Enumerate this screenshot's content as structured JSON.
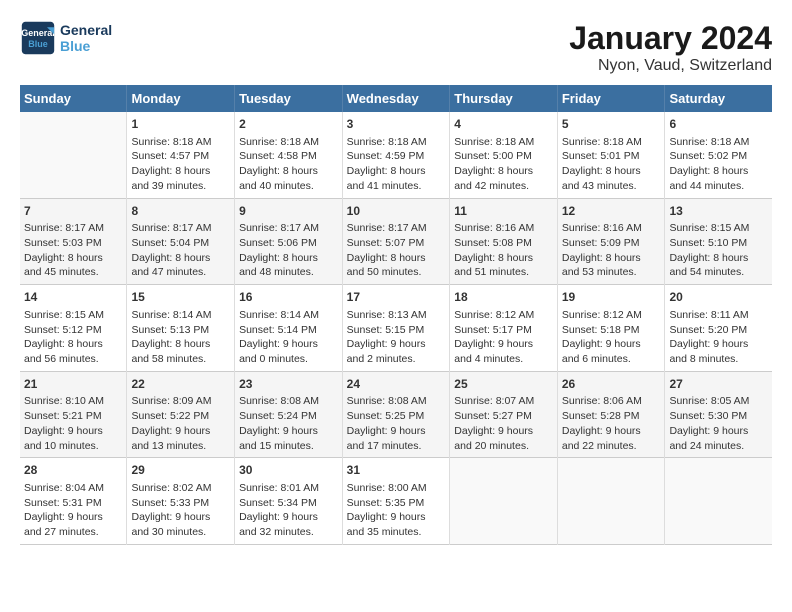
{
  "header": {
    "logo_line1": "General",
    "logo_line2": "Blue",
    "title": "January 2024",
    "subtitle": "Nyon, Vaud, Switzerland"
  },
  "days_of_week": [
    "Sunday",
    "Monday",
    "Tuesday",
    "Wednesday",
    "Thursday",
    "Friday",
    "Saturday"
  ],
  "weeks": [
    [
      {
        "day": "",
        "info": ""
      },
      {
        "day": "1",
        "info": "Sunrise: 8:18 AM\nSunset: 4:57 PM\nDaylight: 8 hours\nand 39 minutes."
      },
      {
        "day": "2",
        "info": "Sunrise: 8:18 AM\nSunset: 4:58 PM\nDaylight: 8 hours\nand 40 minutes."
      },
      {
        "day": "3",
        "info": "Sunrise: 8:18 AM\nSunset: 4:59 PM\nDaylight: 8 hours\nand 41 minutes."
      },
      {
        "day": "4",
        "info": "Sunrise: 8:18 AM\nSunset: 5:00 PM\nDaylight: 8 hours\nand 42 minutes."
      },
      {
        "day": "5",
        "info": "Sunrise: 8:18 AM\nSunset: 5:01 PM\nDaylight: 8 hours\nand 43 minutes."
      },
      {
        "day": "6",
        "info": "Sunrise: 8:18 AM\nSunset: 5:02 PM\nDaylight: 8 hours\nand 44 minutes."
      }
    ],
    [
      {
        "day": "7",
        "info": "Sunrise: 8:17 AM\nSunset: 5:03 PM\nDaylight: 8 hours\nand 45 minutes."
      },
      {
        "day": "8",
        "info": "Sunrise: 8:17 AM\nSunset: 5:04 PM\nDaylight: 8 hours\nand 47 minutes."
      },
      {
        "day": "9",
        "info": "Sunrise: 8:17 AM\nSunset: 5:06 PM\nDaylight: 8 hours\nand 48 minutes."
      },
      {
        "day": "10",
        "info": "Sunrise: 8:17 AM\nSunset: 5:07 PM\nDaylight: 8 hours\nand 50 minutes."
      },
      {
        "day": "11",
        "info": "Sunrise: 8:16 AM\nSunset: 5:08 PM\nDaylight: 8 hours\nand 51 minutes."
      },
      {
        "day": "12",
        "info": "Sunrise: 8:16 AM\nSunset: 5:09 PM\nDaylight: 8 hours\nand 53 minutes."
      },
      {
        "day": "13",
        "info": "Sunrise: 8:15 AM\nSunset: 5:10 PM\nDaylight: 8 hours\nand 54 minutes."
      }
    ],
    [
      {
        "day": "14",
        "info": "Sunrise: 8:15 AM\nSunset: 5:12 PM\nDaylight: 8 hours\nand 56 minutes."
      },
      {
        "day": "15",
        "info": "Sunrise: 8:14 AM\nSunset: 5:13 PM\nDaylight: 8 hours\nand 58 minutes."
      },
      {
        "day": "16",
        "info": "Sunrise: 8:14 AM\nSunset: 5:14 PM\nDaylight: 9 hours\nand 0 minutes."
      },
      {
        "day": "17",
        "info": "Sunrise: 8:13 AM\nSunset: 5:15 PM\nDaylight: 9 hours\nand 2 minutes."
      },
      {
        "day": "18",
        "info": "Sunrise: 8:12 AM\nSunset: 5:17 PM\nDaylight: 9 hours\nand 4 minutes."
      },
      {
        "day": "19",
        "info": "Sunrise: 8:12 AM\nSunset: 5:18 PM\nDaylight: 9 hours\nand 6 minutes."
      },
      {
        "day": "20",
        "info": "Sunrise: 8:11 AM\nSunset: 5:20 PM\nDaylight: 9 hours\nand 8 minutes."
      }
    ],
    [
      {
        "day": "21",
        "info": "Sunrise: 8:10 AM\nSunset: 5:21 PM\nDaylight: 9 hours\nand 10 minutes."
      },
      {
        "day": "22",
        "info": "Sunrise: 8:09 AM\nSunset: 5:22 PM\nDaylight: 9 hours\nand 13 minutes."
      },
      {
        "day": "23",
        "info": "Sunrise: 8:08 AM\nSunset: 5:24 PM\nDaylight: 9 hours\nand 15 minutes."
      },
      {
        "day": "24",
        "info": "Sunrise: 8:08 AM\nSunset: 5:25 PM\nDaylight: 9 hours\nand 17 minutes."
      },
      {
        "day": "25",
        "info": "Sunrise: 8:07 AM\nSunset: 5:27 PM\nDaylight: 9 hours\nand 20 minutes."
      },
      {
        "day": "26",
        "info": "Sunrise: 8:06 AM\nSunset: 5:28 PM\nDaylight: 9 hours\nand 22 minutes."
      },
      {
        "day": "27",
        "info": "Sunrise: 8:05 AM\nSunset: 5:30 PM\nDaylight: 9 hours\nand 24 minutes."
      }
    ],
    [
      {
        "day": "28",
        "info": "Sunrise: 8:04 AM\nSunset: 5:31 PM\nDaylight: 9 hours\nand 27 minutes."
      },
      {
        "day": "29",
        "info": "Sunrise: 8:02 AM\nSunset: 5:33 PM\nDaylight: 9 hours\nand 30 minutes."
      },
      {
        "day": "30",
        "info": "Sunrise: 8:01 AM\nSunset: 5:34 PM\nDaylight: 9 hours\nand 32 minutes."
      },
      {
        "day": "31",
        "info": "Sunrise: 8:00 AM\nSunset: 5:35 PM\nDaylight: 9 hours\nand 35 minutes."
      },
      {
        "day": "",
        "info": ""
      },
      {
        "day": "",
        "info": ""
      },
      {
        "day": "",
        "info": ""
      }
    ]
  ]
}
